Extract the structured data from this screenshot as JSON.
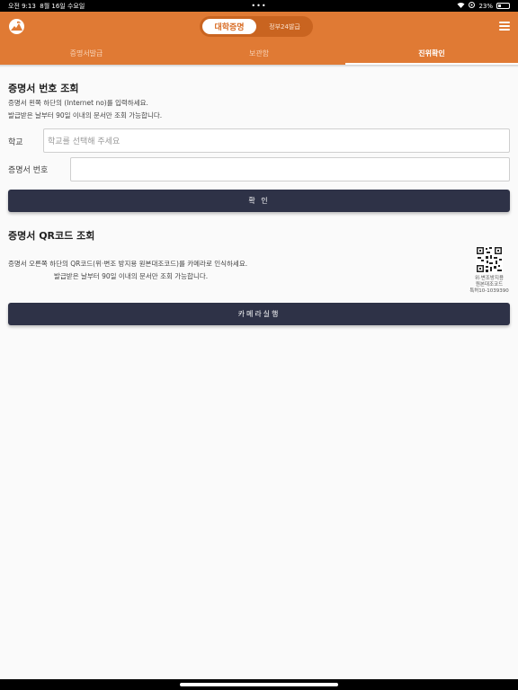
{
  "status": {
    "time": "오전 9:13",
    "date": "8월 16일 수요일",
    "dots": "•••",
    "battery": "23%"
  },
  "header": {
    "seg_active": "대학증명",
    "seg_inactive": "정부24발급"
  },
  "tabs": [
    {
      "label": "증명서발급"
    },
    {
      "label": "보관함"
    },
    {
      "label": "진위확인"
    }
  ],
  "number_lookup": {
    "title": "증명서 번호 조회",
    "desc1": "증명서 왼쪽 하단의 (Internet no)를 입력하세요.",
    "desc2": "발급받은 날부터 90일 이내의 문서만 조회 가능합니다.",
    "school_label": "학교",
    "school_placeholder": "학교를 선택해 주세요",
    "cert_label": "증명서 번호",
    "cert_value": "",
    "confirm": "확 인"
  },
  "qr_lookup": {
    "title": "증명서 QR코드 조회",
    "desc1": "증명서 오른쪽 하단의 QR코드(위·변조 방지용 원본대조코드)를 카메라로 인식하세요.",
    "desc2": "발급받은 날부터 90일 이내의 문서만 조회 가능합니다.",
    "qr_caption1": "위·변조방지용",
    "qr_caption2": "원본대조코드",
    "qr_caption3": "특허10-1039390",
    "camera": "카메라실행"
  }
}
